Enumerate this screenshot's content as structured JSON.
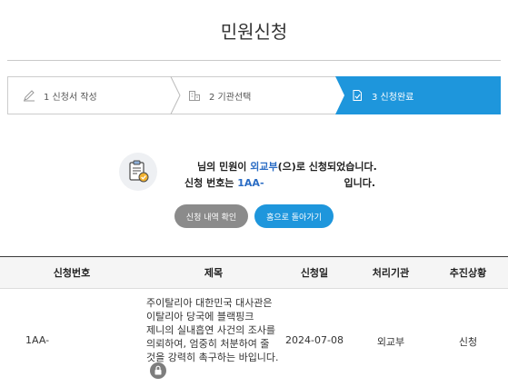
{
  "page_title": "민원신청",
  "stepper": {
    "steps": [
      {
        "label": "1 신청서 작성",
        "active": false,
        "icon": "pencil-icon"
      },
      {
        "label": "2 기관선택",
        "active": false,
        "icon": "building-icon"
      },
      {
        "label": "3 신청완료",
        "active": true,
        "icon": "check-document-icon"
      }
    ]
  },
  "message": {
    "icon": "clipboard-check-icon",
    "line1_prefix": "님의 민원이 ",
    "agency": "외교부",
    "line1_suffix": "(으)로 신청되었습니다.",
    "line2_prefix": "신청 번호는 ",
    "request_no": "1AA-",
    "line2_suffix": "입니다."
  },
  "buttons": {
    "history": "신청 내역 확인",
    "home": "홈으로 돌아가기"
  },
  "table": {
    "headers": [
      "신청번호",
      "제목",
      "신청일",
      "처리기관",
      "추진상황"
    ],
    "rows": [
      {
        "request_no": "1AA-",
        "subject": "주이탈리아 대한민국 대사관은 이탈리아 당국에 블랙핑크 제니의 실내흡연 사건의 조사를 의뢰하여, 엄중히 처분하여 줄 것을 강력히 촉구하는 바입니다.",
        "date": "2024-07-08",
        "agency": "외교부",
        "status": "신청",
        "locked_icon": "lock-icon"
      }
    ]
  },
  "colors": {
    "active_step": "#1e96dc",
    "home_button": "#1e96dc",
    "history_button": "#8b8b8b",
    "link_text": "#2a6cc4"
  }
}
